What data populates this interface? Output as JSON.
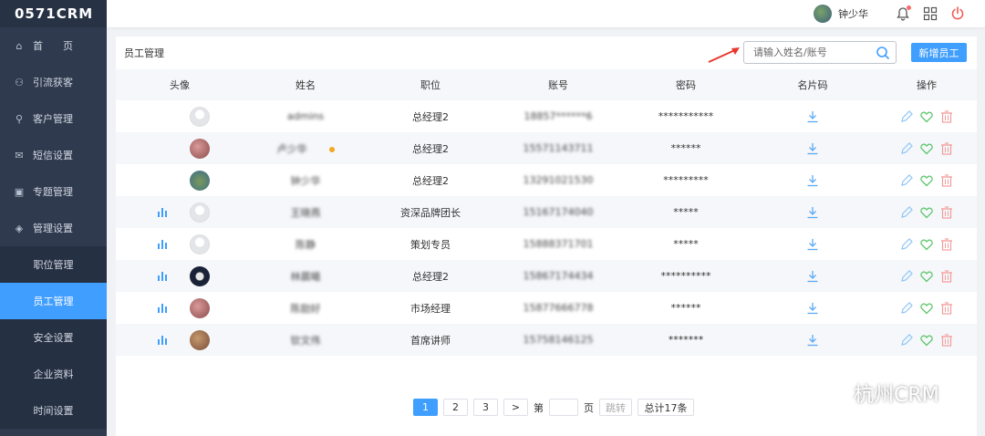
{
  "app": {
    "logo": "0571CRM"
  },
  "sidebar": {
    "items": [
      {
        "label": "首　　页",
        "icon": "home-icon"
      },
      {
        "label": "引流获客",
        "icon": "traffic-icon"
      },
      {
        "label": "客户管理",
        "icon": "user-icon"
      },
      {
        "label": "短信设置",
        "icon": "mail-icon"
      },
      {
        "label": "专题管理",
        "icon": "topic-icon"
      },
      {
        "label": "管理设置",
        "icon": "layers-icon"
      }
    ],
    "submenu": [
      {
        "label": "职位管理"
      },
      {
        "label": "员工管理",
        "active": true
      },
      {
        "label": "安全设置"
      },
      {
        "label": "企业资料"
      },
      {
        "label": "时间设置"
      }
    ],
    "active_color": "#409eff"
  },
  "topbar": {
    "username": "钟少华"
  },
  "panel": {
    "title": "员工管理",
    "search": {
      "placeholder": "请输入姓名/账号",
      "value": ""
    },
    "add_label": "新增员工"
  },
  "table": {
    "columns": [
      "头像",
      "姓名",
      "职位",
      "账号",
      "密码",
      "名片码",
      "操作"
    ],
    "rows": [
      {
        "name": "admins",
        "position": "总经理2",
        "account": "18857******6",
        "password": "***********",
        "bars": false,
        "avatar": "grey",
        "dot": false
      },
      {
        "name": "卢少华",
        "position": "总经理2",
        "account": "15571143711",
        "password": "******",
        "bars": false,
        "avatar": "photo1",
        "dot": true
      },
      {
        "name": "钟少华",
        "position": "总经理2",
        "account": "13291021530",
        "password": "*********",
        "bars": false,
        "avatar": "photo2",
        "dot": false
      },
      {
        "name": "王晓燕",
        "position": "资深品牌团长",
        "account": "15167174040",
        "password": "*****",
        "bars": true,
        "avatar": "grey",
        "dot": false
      },
      {
        "name": "陈静",
        "position": "策划专员",
        "account": "15888371701",
        "password": "*****",
        "bars": true,
        "avatar": "grey",
        "dot": false
      },
      {
        "name": "林晨曦",
        "position": "总经理2",
        "account": "15867174434",
        "password": "**********",
        "bars": true,
        "avatar": "photo3",
        "dot": false
      },
      {
        "name": "陈励好",
        "position": "市场经理",
        "account": "15877666778",
        "password": "******",
        "bars": true,
        "avatar": "photo1",
        "dot": false
      },
      {
        "name": "钦文伟",
        "position": "首席讲师",
        "account": "15758146125",
        "password": "*******",
        "bars": true,
        "avatar": "photo4",
        "dot": false
      }
    ]
  },
  "pagination": {
    "pages": [
      "1",
      "2",
      "3"
    ],
    "next": ">",
    "goto_label": "第",
    "page_unit": "页",
    "jump_label": "跳转",
    "total_label": "总计17条"
  },
  "watermark": {
    "text": "杭州CRM"
  }
}
